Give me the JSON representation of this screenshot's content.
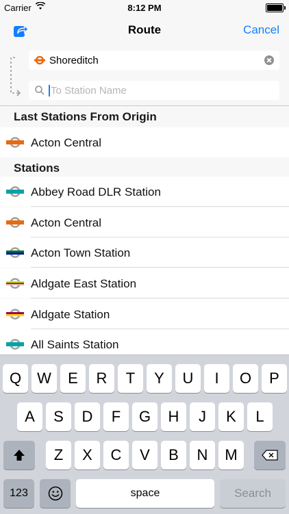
{
  "status_bar": {
    "carrier": "Carrier",
    "time": "8:12 PM",
    "battery_level": 1.0
  },
  "navbar": {
    "title": "Route",
    "cancel_label": "Cancel",
    "share_icon": "share-icon"
  },
  "route": {
    "from_station": "Shoreditch",
    "to_placeholder": "To Station Name",
    "to_value": ""
  },
  "sections": [
    {
      "title": "Last Stations From Origin",
      "rows": [
        {
          "label": "Acton Central",
          "lines": [
            "#e86a10"
          ]
        }
      ]
    },
    {
      "title": "Stations",
      "rows": [
        {
          "label": "Abbey Road DLR Station",
          "lines": [
            "#00a4a7"
          ]
        },
        {
          "label": "Acton Central",
          "lines": [
            "#e86a10"
          ]
        },
        {
          "label": "Acton Town Station",
          "lines": [
            "#007229",
            "#0019a8"
          ]
        },
        {
          "label": "Aldgate East Station",
          "lines": [
            "#ffd300",
            "#00782a",
            "#f3a9bb"
          ]
        },
        {
          "label": "Aldgate Station",
          "lines": [
            "#9b0056",
            "#ffd300"
          ]
        },
        {
          "label": "All Saints Station",
          "lines": [
            "#00a4a7"
          ]
        }
      ]
    }
  ],
  "keyboard": {
    "row1": [
      "Q",
      "W",
      "E",
      "R",
      "T",
      "Y",
      "U",
      "I",
      "O",
      "P"
    ],
    "row2": [
      "A",
      "S",
      "D",
      "F",
      "G",
      "H",
      "J",
      "K",
      "L"
    ],
    "row3": [
      "Z",
      "X",
      "C",
      "V",
      "B",
      "N",
      "M"
    ],
    "numbers_label": "123",
    "space_label": "space",
    "search_label": "Search"
  },
  "colors": {
    "accent": "#147efb",
    "overground": "#e86a10",
    "dlr": "#00a4a7"
  }
}
